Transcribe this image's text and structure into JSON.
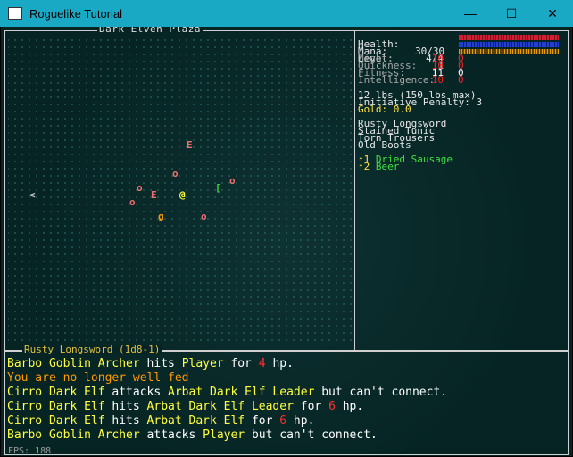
{
  "window": {
    "title": "Roguelike Tutorial",
    "minimize": "—",
    "maximize": "☐",
    "close": "✕"
  },
  "map": {
    "title": "Dark Elven Plaza"
  },
  "entities": [
    {
      "glyph": "E",
      "color": "#f07070"
    },
    {
      "glyph": "o",
      "color": "#f07070"
    },
    {
      "glyph": "o",
      "color": "#f07070"
    },
    {
      "glyph": "E",
      "color": "#f07070"
    },
    {
      "glyph": "@",
      "color": "#ffff40"
    },
    {
      "glyph": "[",
      "color": "#40d040"
    },
    {
      "glyph": "o",
      "color": "#f07070"
    },
    {
      "glyph": "o",
      "color": "#f07070"
    },
    {
      "glyph": "g",
      "color": "#ff9a00"
    },
    {
      "glyph": "o",
      "color": "#f07070"
    },
    {
      "glyph": "<",
      "color": "#c8c8c8"
    }
  ],
  "stats": {
    "health_label": "Health:",
    "health_value": "30/30",
    "mana_label": "Mana:",
    "mana_value": "4/4",
    "level_label": "Level:",
    "level_value": "1",
    "attrs": [
      {
        "label": "Might:",
        "a": "10",
        "b": "0"
      },
      {
        "label": "Quickness:",
        "a": "10",
        "b": "0"
      },
      {
        "label": "Fitness:",
        "a": "11",
        "b": "0"
      },
      {
        "label": "Intelligence:",
        "a": "10",
        "b": "0"
      }
    ]
  },
  "inventory": {
    "weight": "12 lbs (150 lbs max)",
    "initiative": "Initiative Penalty: 3",
    "gold": "Gold: 0.0",
    "equipped": [
      "Rusty Longsword",
      "Stained Tunic",
      "Torn Trousers",
      "Old Boots"
    ],
    "consumables": [
      {
        "key": "↑1",
        "name": "Dried Sausage"
      },
      {
        "key": "↑2",
        "name": "Beer"
      }
    ]
  },
  "weapon_label": "Rusty Longsword (1d8-1)",
  "log": [
    [
      {
        "t": "Barbo Goblin Archer",
        "c": "y"
      },
      {
        "t": " hits ",
        "c": "w"
      },
      {
        "t": "Player",
        "c": "y"
      },
      {
        "t": " for ",
        "c": "w"
      },
      {
        "t": "4",
        "c": "r"
      },
      {
        "t": " hp.",
        "c": "w"
      }
    ],
    [
      {
        "t": "You are no longer well fed",
        "c": "o"
      }
    ],
    [
      {
        "t": "Cirro Dark Elf",
        "c": "y"
      },
      {
        "t": " attacks ",
        "c": "w"
      },
      {
        "t": "Arbat Dark Elf Leader",
        "c": "y"
      },
      {
        "t": " but can't connect.",
        "c": "w"
      }
    ],
    [
      {
        "t": "Cirro Dark Elf",
        "c": "y"
      },
      {
        "t": " hits ",
        "c": "w"
      },
      {
        "t": "Arbat Dark Elf Leader",
        "c": "y"
      },
      {
        "t": " for ",
        "c": "w"
      },
      {
        "t": "6",
        "c": "r"
      },
      {
        "t": " hp.",
        "c": "w"
      }
    ],
    [
      {
        "t": "Cirro Dark Elf",
        "c": "y"
      },
      {
        "t": " hits ",
        "c": "w"
      },
      {
        "t": "Arbat Dark Elf",
        "c": "y"
      },
      {
        "t": " for ",
        "c": "w"
      },
      {
        "t": "6",
        "c": "r"
      },
      {
        "t": " hp.",
        "c": "w"
      }
    ],
    [
      {
        "t": "Barbo Goblin Archer",
        "c": "y"
      },
      {
        "t": " attacks ",
        "c": "w"
      },
      {
        "t": "Player",
        "c": "y"
      },
      {
        "t": " but can't connect.",
        "c": "w"
      }
    ]
  ],
  "fps": "FPS: 188"
}
